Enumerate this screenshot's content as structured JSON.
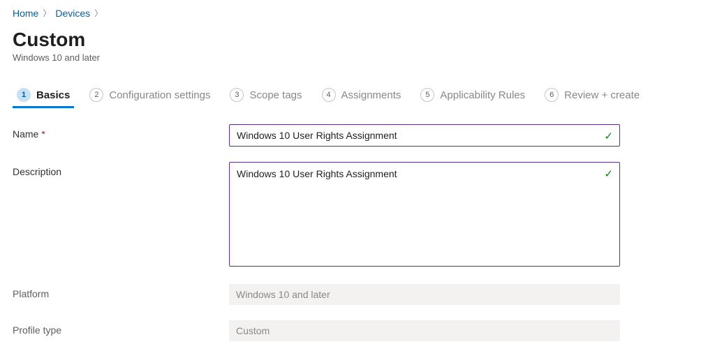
{
  "breadcrumb": {
    "home": "Home",
    "devices": "Devices"
  },
  "header": {
    "title": "Custom",
    "subtitle": "Windows 10 and later"
  },
  "steps": [
    {
      "num": "1",
      "label": "Basics"
    },
    {
      "num": "2",
      "label": "Configuration settings"
    },
    {
      "num": "3",
      "label": "Scope tags"
    },
    {
      "num": "4",
      "label": "Assignments"
    },
    {
      "num": "5",
      "label": "Applicability Rules"
    },
    {
      "num": "6",
      "label": "Review + create"
    }
  ],
  "form": {
    "name_label": "Name",
    "name_value": "Windows 10 User Rights Assignment",
    "description_label": "Description",
    "description_value": "Windows 10 User Rights Assignment",
    "platform_label": "Platform",
    "platform_value": "Windows 10 and later",
    "profile_type_label": "Profile type",
    "profile_type_value": "Custom"
  }
}
